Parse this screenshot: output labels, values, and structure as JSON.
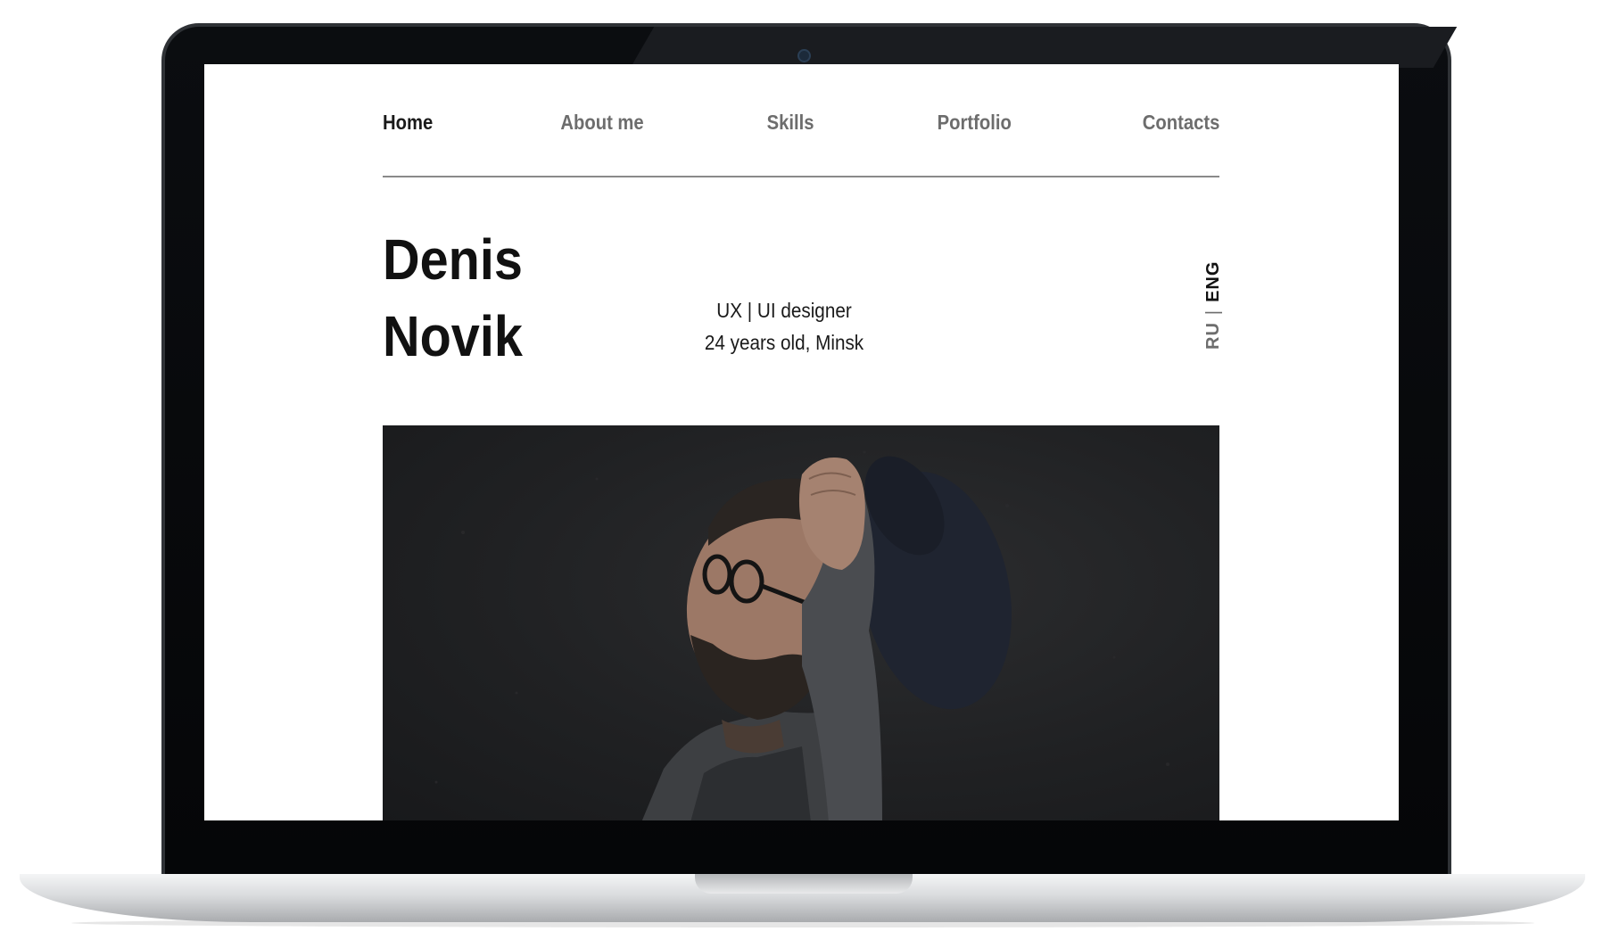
{
  "nav": {
    "items": [
      {
        "label": "Home",
        "active": true
      },
      {
        "label": "About me",
        "active": false
      },
      {
        "label": "Skills",
        "active": false
      },
      {
        "label": "Portfolio",
        "active": false
      },
      {
        "label": "Contacts",
        "active": false
      }
    ]
  },
  "hero": {
    "first_name": "Denis",
    "last_name": "Novik",
    "role": "UX | UI designer",
    "details": "24 years old, Minsk"
  },
  "language": {
    "ru": "RU",
    "separator": "|",
    "eng": "ENG",
    "selected": "ENG"
  },
  "colors": {
    "nav_active": "#1a1a1a",
    "nav_inactive": "#6d6d6d",
    "photo_background": "#202123"
  }
}
